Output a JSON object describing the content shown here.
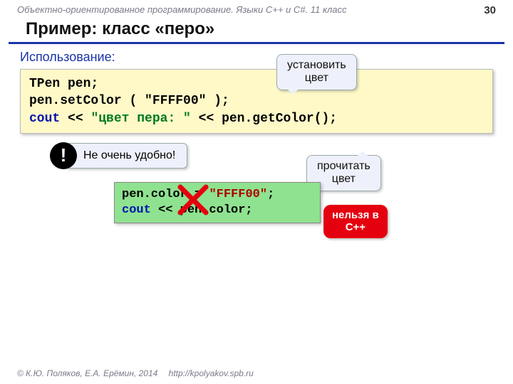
{
  "header": {
    "course": "Объектно-ориентированное программирование. Языки C++ и C#. 11 класс",
    "page": "30"
  },
  "title": "Пример: класс «перо»",
  "section": "Использование:",
  "code1": {
    "l1a": "TPen pen;",
    "l2a": "pen.setColor",
    "l2b": "( \"FFFF00\" );",
    "l3a": "cout",
    "l3b": " << ",
    "l3c": "\"цвет пера: \"",
    "l3d": " << pen.getColor();"
  },
  "callouts": {
    "set": "установить\nцвет",
    "get": "прочитать\nцвет",
    "bang": "!",
    "note": "Не очень удобно!",
    "forbidden": "нельзя в\nC++"
  },
  "code2": {
    "l1a": "pen.color",
    "l1b": "=",
    "l1c": "\"FFFF00\"",
    "l1d": ";",
    "l2a": "cout",
    "l2b": " << pen.color;"
  },
  "footer": {
    "copyright": "© К.Ю. Поляков, Е.А. Ерёмин, 2014",
    "url": "http://kpolyakov.spb.ru"
  }
}
